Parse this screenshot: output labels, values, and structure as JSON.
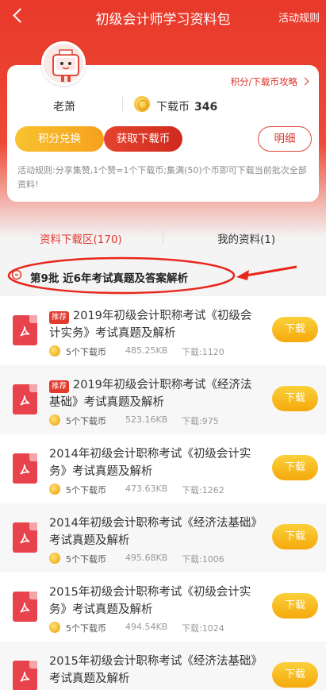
{
  "header": {
    "title": "初级会计师学习资料包",
    "rules_label": "活动规则"
  },
  "profile": {
    "username": "老萧",
    "coins_label": "下载币",
    "coins_count": "346",
    "attack_link": "积分/下载币攻略"
  },
  "actions": {
    "exchange": "积分兑换",
    "get_coins": "获取下载币",
    "detail": "明细"
  },
  "rule_text": "活动规则:分享集赞,1个赞=1个下载币;集满(50)个币即可下载当前批次全部资料!",
  "tabs": [
    {
      "label": "资料下载区(170)"
    },
    {
      "label": "我的资料(1)"
    }
  ],
  "batch_title": "第9批 近6年考试真题及答案解析",
  "colors": {
    "accent": "#e8392a",
    "button_orange": "#f5a90c"
  },
  "items": [
    {
      "tag": "推荐",
      "title": "2019年初级会计职称考试《初级会计实务》考试真题及解析",
      "price": "5个下载币",
      "size": "485.25KB",
      "downloads": "下载:1120",
      "button": "下载"
    },
    {
      "tag": "推荐",
      "title": "2019年初级会计职称考试《经济法基础》考试真题及解析",
      "price": "5个下载币",
      "size": "523.16KB",
      "downloads": "下载:975",
      "button": "下载"
    },
    {
      "tag": "",
      "title": "2014年初级会计职称考试《初级会计实务》考试真题及解析",
      "price": "5个下载币",
      "size": "473.63KB",
      "downloads": "下载:1262",
      "button": "下载"
    },
    {
      "tag": "",
      "title": "2014年初级会计职称考试《经济法基础》考试真题及解析",
      "price": "5个下载币",
      "size": "495.68KB",
      "downloads": "下载:1006",
      "button": "下载"
    },
    {
      "tag": "",
      "title": "2015年初级会计职称考试《初级会计实务》考试真题及解析",
      "price": "5个下载币",
      "size": "494.54KB",
      "downloads": "下载:1024",
      "button": "下载"
    },
    {
      "tag": "",
      "title": "2015年初级会计职称考试《经济法基础》考试真题及解析",
      "price": "",
      "size": "",
      "downloads": "",
      "button": "下载"
    }
  ]
}
